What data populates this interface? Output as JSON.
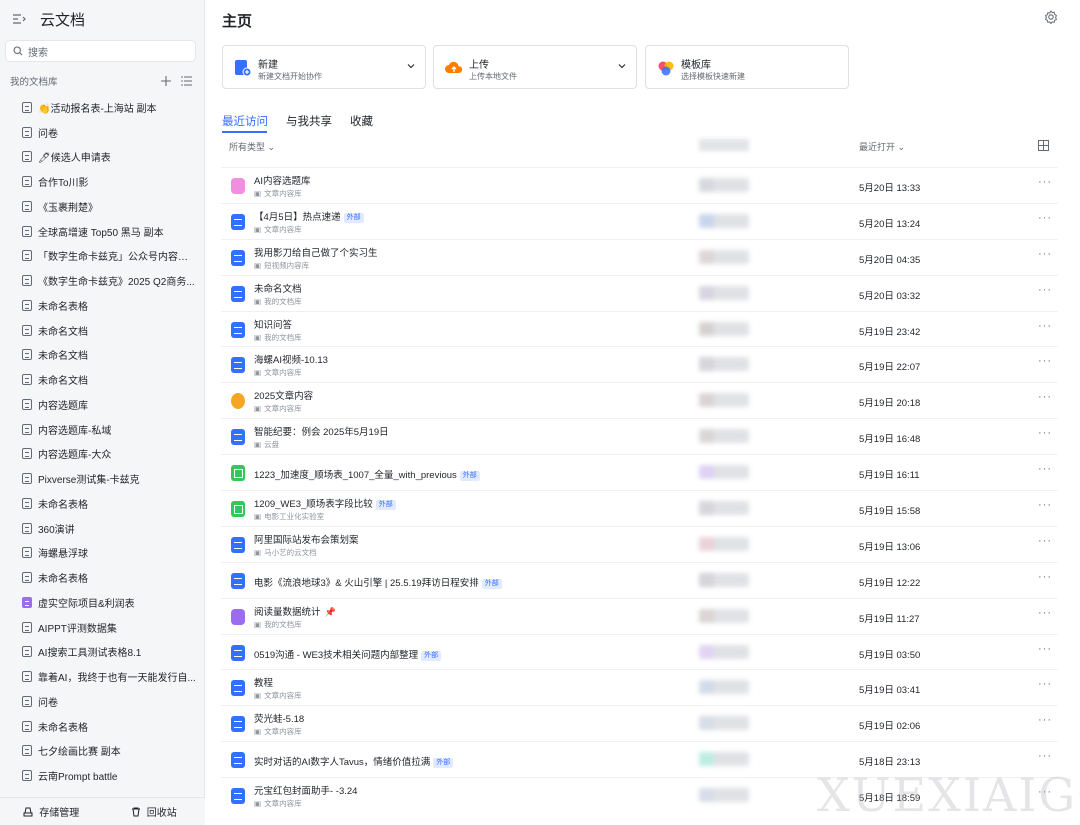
{
  "sidebar": {
    "app_title": "云文档",
    "search_placeholder": "搜索",
    "library_label": "我的文档库",
    "items": [
      {
        "label": "👏活动报名表-上海站 副本",
        "icon": "doc-icon"
      },
      {
        "label": "问卷",
        "icon": "form-icon"
      },
      {
        "label": "🖊候选人申请表",
        "icon": "doc-icon"
      },
      {
        "label": "合作To川影",
        "icon": "sheet-icon"
      },
      {
        "label": "《玉裹荆楚》",
        "icon": "doc-icon"
      },
      {
        "label": "全球高增速 Top50 黑马 副本",
        "icon": "sheet-icon"
      },
      {
        "label": "「数字生命卡兹克」公众号内容匯...",
        "icon": "doc-icon"
      },
      {
        "label": "《数字生命卡兹克》2025 Q2商务...",
        "icon": "doc-icon"
      },
      {
        "label": "未命名表格",
        "icon": "sheet-icon"
      },
      {
        "label": "未命名文档",
        "icon": "doc-icon"
      },
      {
        "label": "未命名文档",
        "icon": "doc-icon"
      },
      {
        "label": "未命名文档",
        "icon": "doc-icon"
      },
      {
        "label": "内容选题库",
        "icon": "sheet-icon"
      },
      {
        "label": "内容选题库-私域",
        "icon": "sheet-icon"
      },
      {
        "label": "内容选题库-大众",
        "icon": "sheet-icon"
      },
      {
        "label": "Pixverse测试集-卡兹克",
        "icon": "sheet-icon"
      },
      {
        "label": "未命名表格",
        "icon": "sheet-icon"
      },
      {
        "label": "360演讲",
        "icon": "doc-icon"
      },
      {
        "label": "海螺悬浮球",
        "icon": "doc-icon"
      },
      {
        "label": "未命名表格",
        "icon": "sheet-icon"
      },
      {
        "label": "虚实空际项目&利润表",
        "icon": "base-icon"
      },
      {
        "label": "AIPPT评测数据集",
        "icon": "sheet-icon"
      },
      {
        "label": "AI搜索工具测试表格8.1",
        "icon": "sheet-icon"
      },
      {
        "label": "靠着AI，我终于也有一天能发行自...",
        "icon": "doc-icon"
      },
      {
        "label": "问卷",
        "icon": "form-icon"
      },
      {
        "label": "未命名表格",
        "icon": "sheet-icon"
      },
      {
        "label": "七夕绘画比赛 副本",
        "icon": "doc-icon"
      },
      {
        "label": "云南Prompt battle",
        "icon": "doc-icon"
      }
    ],
    "footer": {
      "storage": "存储管理",
      "trash": "回收站"
    }
  },
  "main": {
    "title": "主页",
    "cards": [
      {
        "title": "新建",
        "subtitle": "新建文档开始协作",
        "icon": "new-doc-icon"
      },
      {
        "title": "上传",
        "subtitle": "上传本地文件",
        "icon": "upload-icon"
      },
      {
        "title": "模板库",
        "subtitle": "选择模板快速新建",
        "icon": "template-icon"
      }
    ],
    "tabs": [
      "最近访问",
      "与我共享",
      "收藏"
    ],
    "columns": {
      "type": "所有类型 ⌄",
      "time": "最近打开 ⌄"
    },
    "external_tag": "外部",
    "rows": [
      {
        "title": "AI内容选题库",
        "location": "文章内容库",
        "time": "5月20日 13:33",
        "icon": "ai",
        "ext": false
      },
      {
        "title": "【4月5日】热点速递",
        "location": "文章内容库",
        "time": "5月20日 13:24",
        "icon": "doc",
        "ext": true
      },
      {
        "title": "我用影刀给自己做了个实习生",
        "location": "短视频内容库",
        "time": "5月20日 04:35",
        "icon": "doc",
        "ext": false
      },
      {
        "title": "未命名文档",
        "location": "我的文档库",
        "time": "5月20日 03:32",
        "icon": "doc",
        "ext": false
      },
      {
        "title": "知识问答",
        "location": "我的文档库",
        "time": "5月19日 23:42",
        "icon": "doc",
        "ext": false
      },
      {
        "title": "海螺AI视频-10.13",
        "location": "文章内容库",
        "time": "5月19日 22:07",
        "icon": "doc",
        "ext": false
      },
      {
        "title": "2025文章内容",
        "location": "文章内容库",
        "time": "5月19日 20:18",
        "icon": "colorful",
        "ext": false
      },
      {
        "title": "智能纪要：例会 2025年5月19日",
        "location": "云盘",
        "time": "5月19日 16:48",
        "icon": "doc",
        "ext": false
      },
      {
        "title": "1223_加速度_顺场表_1007_全量_with_previous",
        "location": "",
        "time": "5月19日 16:11",
        "icon": "sheet",
        "ext": true
      },
      {
        "title": "1209_WE3_顺场表字段比较",
        "location": "电影工业化实验室",
        "time": "5月19日 15:58",
        "icon": "sheet",
        "ext": true
      },
      {
        "title": "阿里国际站发布会策划案",
        "location": "马小艺的云文档",
        "time": "5月19日 13:06",
        "icon": "doc",
        "ext": false
      },
      {
        "title": "电影《流浪地球3》& 火山引擎 | 25.5.19拜访日程安排",
        "location": "",
        "time": "5月19日 12:22",
        "icon": "doc",
        "ext": true
      },
      {
        "title": "阅读量数据统计",
        "location": "我的文档库",
        "time": "5月19日 11:27",
        "icon": "base",
        "ext": false,
        "pinned": true
      },
      {
        "title": "0519沟通 - WE3技术相关问题内部整理",
        "location": "",
        "time": "5月19日 03:50",
        "icon": "doc",
        "ext": true
      },
      {
        "title": "教程",
        "location": "文章内容库",
        "time": "5月19日 03:41",
        "icon": "doc",
        "ext": false
      },
      {
        "title": "荧光蛙-5.18",
        "location": "文章内容库",
        "time": "5月19日 02:06",
        "icon": "doc",
        "ext": false
      },
      {
        "title": "实时对话的AI数字人Tavus，情绪价值拉满",
        "location": "",
        "time": "5月18日 23:13",
        "icon": "doc",
        "ext": true
      },
      {
        "title": "元宝红包封面助手- -3.24",
        "location": "文章内容库",
        "time": "5月18日 18:59",
        "icon": "doc",
        "ext": false
      }
    ]
  },
  "watermark": "XUEXIAIGC",
  "colors": {
    "accent": "#3370ff",
    "sidebar_bg": "#f5f6f7"
  }
}
